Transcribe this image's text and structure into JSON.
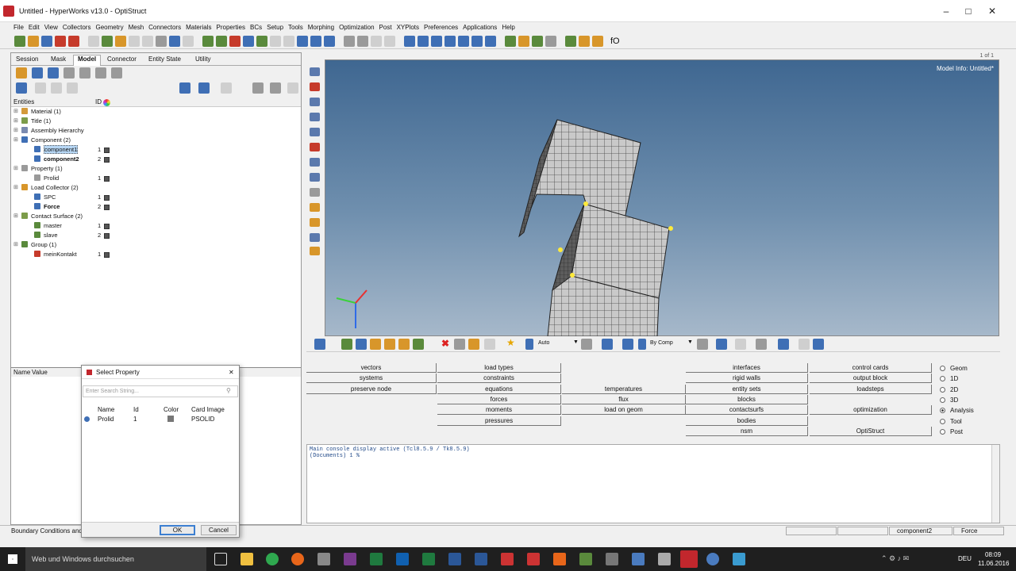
{
  "window": {
    "title": "Untitled - HyperWorks v13.0 - OptiStruct"
  },
  "menu": [
    "File",
    "Edit",
    "View",
    "Collectors",
    "Geometry",
    "Mesh",
    "Connectors",
    "Materials",
    "Properties",
    "BCs",
    "Setup",
    "Tools",
    "Morphing",
    "Optimization",
    "Post",
    "XYPlots",
    "Preferences",
    "Applications",
    "Help"
  ],
  "toolbar": {
    "end_label": "fO"
  },
  "leftpanel": {
    "tabs": [
      "Session",
      "Mask",
      "Model",
      "Connector",
      "Entity State",
      "Utility"
    ],
    "active_tab": "Model",
    "entities_header": "Entities",
    "id_header": "ID",
    "tree": [
      {
        "label": "Material (1)",
        "id": "",
        "color": "#d49a3a"
      },
      {
        "label": "Title (1)",
        "id": "",
        "color": "#7c9c4a"
      },
      {
        "label": "Assembly Hierarchy",
        "id": "",
        "color": "#7a8ab0"
      },
      {
        "label": "Component (2)",
        "id": "",
        "color": "#3f6fb5"
      },
      {
        "label": "component1",
        "id": "1",
        "color": "#3f6fb5"
      },
      {
        "label": "component2",
        "id": "2",
        "color": "#3f6fb5"
      },
      {
        "label": "Property (1)",
        "id": "",
        "color": "#9a9a9a"
      },
      {
        "label": "Prolid",
        "id": "1",
        "color": "#9a9a9a"
      },
      {
        "label": "Load Collector (2)",
        "id": "",
        "color": "#d8962a"
      },
      {
        "label": "SPC",
        "id": "1",
        "color": "#3f6fb5"
      },
      {
        "label": "Force",
        "id": "2",
        "color": "#3f6fb5"
      },
      {
        "label": "Contact Surface (2)",
        "id": "",
        "color": "#7c9c4a"
      },
      {
        "label": "master",
        "id": "1",
        "color": "#5a8a3c"
      },
      {
        "label": "slave",
        "id": "2",
        "color": "#5a8a3c"
      },
      {
        "label": "Group (1)",
        "id": "",
        "color": "#5a8a3c"
      },
      {
        "label": "meinKontakt",
        "id": "1",
        "color": "#c63b2b"
      }
    ],
    "name_header": "Name",
    "value_header": "Value"
  },
  "viewport": {
    "page": "1 of 1",
    "model_info": "Model Info: Untitled*"
  },
  "bottom_toolbar": {
    "auto": "Auto",
    "by_comp": "By Comp"
  },
  "panels": {
    "col1": [
      "vectors",
      "systems",
      "preserve node"
    ],
    "col2": [
      "load types",
      "constraints",
      "equations",
      "forces",
      "moments",
      "pressures"
    ],
    "col3": [
      "",
      "",
      "temperatures",
      "flux",
      "load on geom",
      ""
    ],
    "col4": [
      "interfaces",
      "rigid walls",
      "entity sets",
      "blocks",
      "contactsurfs",
      "bodies",
      "nsm"
    ],
    "col5": [
      "control cards",
      "output block",
      "loadsteps",
      "",
      "optimization",
      "",
      "OptiStruct"
    ],
    "radios": [
      "Geom",
      "1D",
      "2D",
      "3D",
      "Analysis",
      "Tool",
      "Post"
    ],
    "radio_selected": "Analysis"
  },
  "console": {
    "line1": "Main console display active (Tcl8.5.9 / Tk8.5.9)",
    "line2": "(Documents) 1 %"
  },
  "status": {
    "left": "Boundary Conditions and S",
    "comp": "component2",
    "force": "Force"
  },
  "dialog": {
    "title": "Select Property",
    "search_placeholder": "Enter Search String...",
    "headers": [
      "Name",
      "Id",
      "Color",
      "Card Image"
    ],
    "row": {
      "name": "Prolid",
      "id": "1",
      "card": "PSOLID"
    },
    "ok": "OK",
    "cancel": "Cancel"
  },
  "taskbar": {
    "search": "Web und Windows durchsuchen",
    "time": "08:09",
    "date": "11.06.2016",
    "lang": "DEU"
  }
}
